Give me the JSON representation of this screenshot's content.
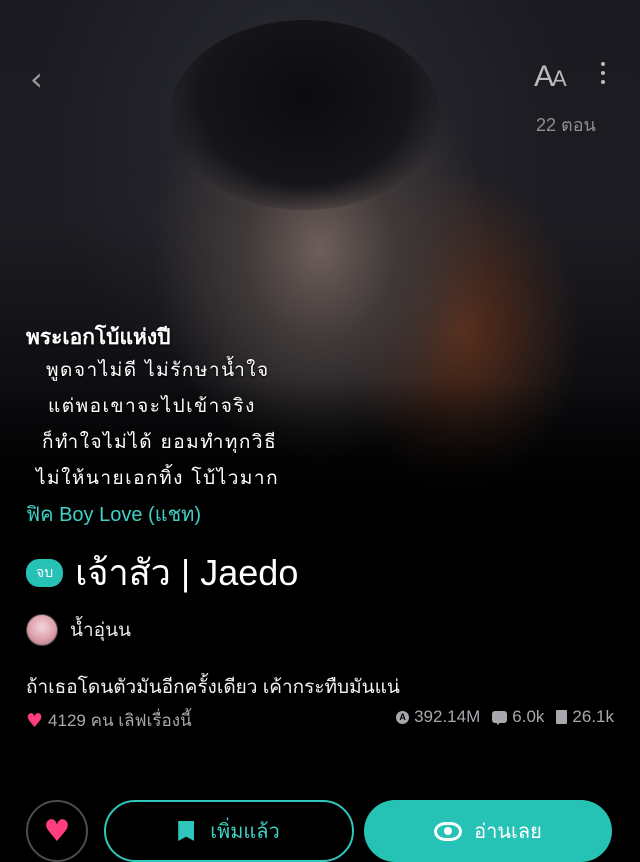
{
  "header": {
    "back_icon": "chevron-left-icon",
    "font_size_label_big": "A",
    "font_size_label_small": "A",
    "more_icon": "more-vertical-icon",
    "episode_count": "22 ตอน"
  },
  "cover_text": {
    "line1": "พระเอกโบ้แห่งปี",
    "line2": "พูดจาไม่ดี ไม่รักษาน้ำใจ",
    "line3": "แต่พอเขาจะไปเข้าจริง",
    "line4": "ก็ทำใจไม่ได้ ยอมทำทุกวิธี",
    "line5": "ไม่ให้นายเอกทิ้ง โบ้ไวมาก"
  },
  "story": {
    "genre": "ฟิค Boy Love (แชท)",
    "status_badge": "จบ",
    "title": "เจ้าสัว | Jaedo",
    "author": "น้ำอุ่นน",
    "tagline": "ถ้าเธอโดนตัวมันอีกครั้งเดียว เค้ากระทืบมันแน่"
  },
  "stats": {
    "likes": "4129 คน เลิฟเรื่องนี้",
    "views": "392.14M",
    "comments": "6.0k",
    "reads": "26.1k"
  },
  "actions": {
    "like_icon": "heart-icon",
    "added_label": "เพิ่มแล้ว",
    "read_label": "อ่านเลย"
  },
  "colors": {
    "accent": "#27c2b6",
    "heart": "#ff3e7f",
    "background": "#000000"
  }
}
